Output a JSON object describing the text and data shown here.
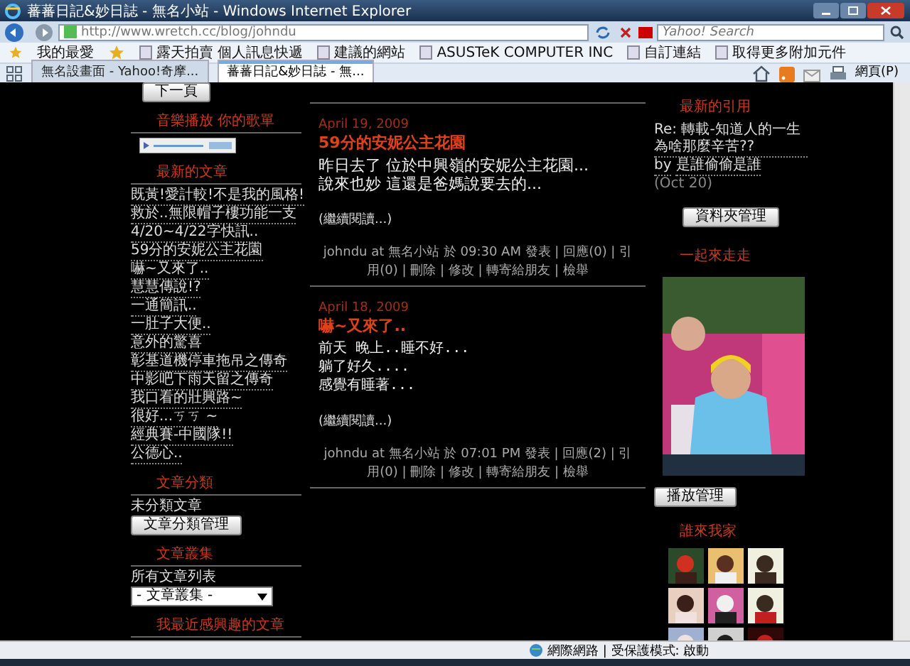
{
  "window": {
    "title": "蕃蕃日記&妙日誌 - 無名小站 - Windows Internet Explorer"
  },
  "toolbar": {
    "address": "http://www.wretch.cc/blog/johndu",
    "search_placeholder": "Yahoo! Search"
  },
  "favorites_bar": {
    "label": "我的最愛",
    "links": [
      "露天拍賣 個人訊息快遞",
      "建議的網站",
      "ASUSTeK COMPUTER INC",
      "自訂連結",
      "取得更多附加元件"
    ]
  },
  "tabs": [
    {
      "label": "無名設畫面 - Yahoo!奇摩...",
      "selected": false
    },
    {
      "label": "蕃蕃日記&妙日誌 - 無...",
      "selected": true
    }
  ],
  "command_bar": {
    "page_menu": "網頁(P)"
  },
  "left_sidebar": {
    "top_button": "下一頁",
    "sections": [
      {
        "kind": "player",
        "title": "音樂播放 你的歌單"
      },
      {
        "kind": "links",
        "title": "最新的文章",
        "items": [
          "既黃!愛計較!不是我的風格!",
          "救於..無限帽子樓功能一支",
          "4/20~4/22字快訊..",
          "59分的安妮公主花園",
          "嚇~又來了..",
          "慧慧傳說!?",
          "一通簡訊..",
          "一肚子大便..",
          "意外的驚喜",
          "彰基道機停車拖吊之傳奇",
          "中影吧下雨天留之傳奇",
          "我口看的壯興路~",
          "很好...ㄎㄎ ~",
          "經典賽-中國隊!!",
          "公德心.."
        ]
      },
      {
        "kind": "category",
        "title": "文章分類",
        "items": [
          "未分類文章"
        ],
        "button": "文章分類管理"
      },
      {
        "kind": "select",
        "title": "文章叢集",
        "label": "所有文章列表",
        "value": "- 文章叢集 -"
      },
      {
        "kind": "heading",
        "title": "我最近感興趣的文章"
      }
    ]
  },
  "posts": [
    {
      "date": "April 19, 2009",
      "title": "59分的安妮公主花園",
      "body": [
        "昨日去了 位於中興嶺的安妮公主花園...",
        "說來也妙 這還是爸媽說要去的..."
      ],
      "more": "(繼續閱讀...)",
      "footer": "johndu at 無名小站 於 09:30 AM 發表 | 回應(0) | 引用(0) | 刪除 | 修改 | 轉寄給朋友 | 檢舉"
    },
    {
      "date": "April 18, 2009",
      "title": "嚇~又來了..",
      "body": [
        "前天 晚上..睡不好...",
        "躺了好久....",
        "感覺有睡著..."
      ],
      "more": "(繼續閱讀...)",
      "footer": "johndu at 無名小站 於 07:01 PM 發表 | 回應(2) | 引用(0) | 刪除 | 修改 | 轉寄給朋友 | 檢舉"
    }
  ],
  "right_sidebar": {
    "sections": [
      {
        "kind": "trackbacks",
        "title": "最新的引用",
        "entries": [
          {
            "text": "Re: 轉載-知道人的一生為啥那麼辛苦??",
            "by": "by",
            "author": "是誰偷偷是誰",
            "date": "(Oct 20)"
          }
        ],
        "button": "資料夾管理"
      },
      {
        "title": "一起來走走",
        "button": "播放管理"
      },
      {
        "kind": "visitors",
        "title": "誰來我家"
      }
    ]
  },
  "status_bar": {
    "zone": "網際網路 | 受保護模式: 啟動"
  }
}
